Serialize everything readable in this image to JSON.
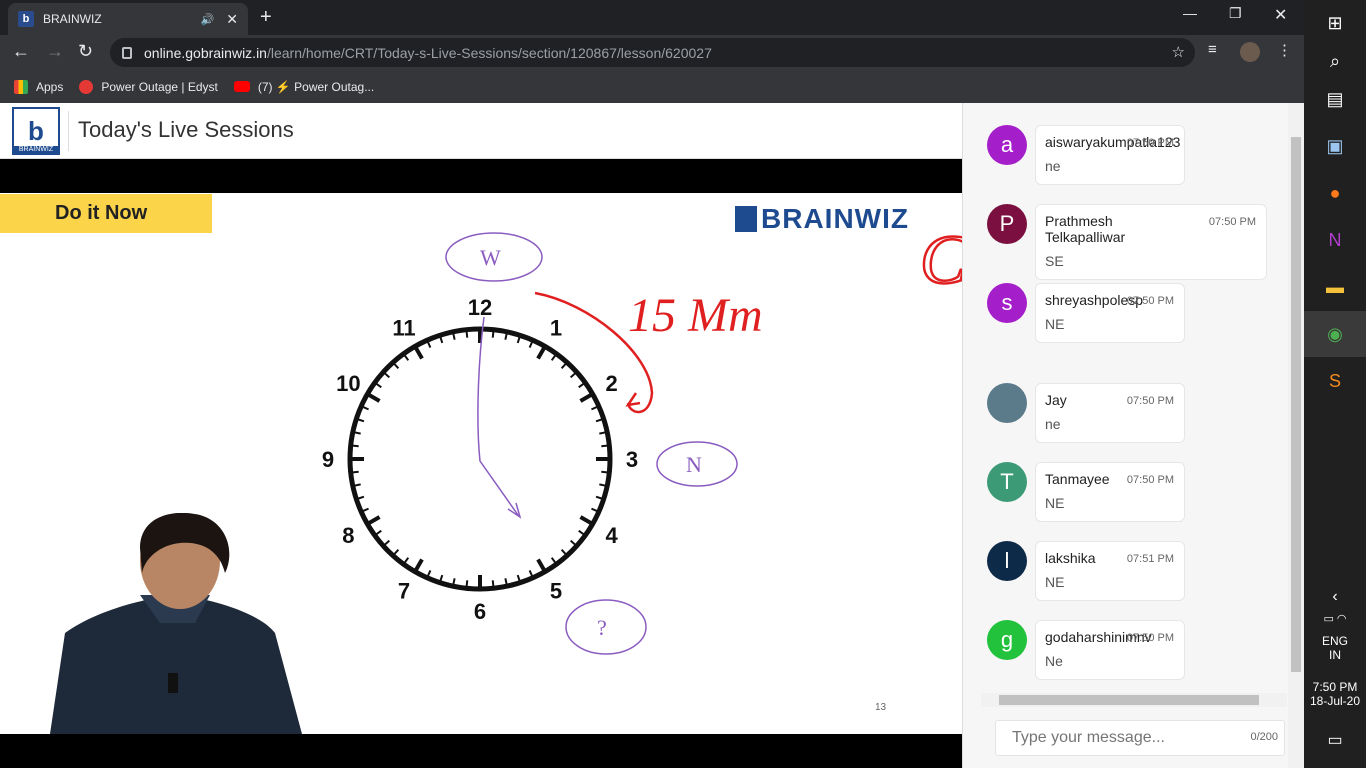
{
  "browser": {
    "tab_title": "BRAINWIZ",
    "url_host": "online.gobrainwiz.in",
    "url_path": "/learn/home/CRT/Today-s-Live-Sessions/section/120867/lesson/620027",
    "bookmarks": [
      "Apps",
      "Power Outage | Edyst",
      "(7) ⚡ Power Outag..."
    ]
  },
  "header": {
    "logo_text": "BRAINWIZ",
    "title": "Today's Live Sessions"
  },
  "slide": {
    "banner": "Do it Now",
    "brand": "BRAINWIZ",
    "page_number": "13",
    "clock_numbers": [
      "12",
      "1",
      "2",
      "3",
      "4",
      "5",
      "6",
      "7",
      "8",
      "9",
      "10",
      "11"
    ],
    "annotations": {
      "top_circle": "W",
      "right_circle": "N",
      "bottom_circle": "?",
      "scribble1": "15 Mm",
      "scribble2": "Chyder"
    }
  },
  "chat": {
    "messages": [
      {
        "avatar": "a",
        "color": "#a41ec9",
        "name": "aiswaryakumpatla123",
        "time": "07:50 PM",
        "text": "ne"
      },
      {
        "avatar": "P",
        "color": "#7b1040",
        "name": "Prathmesh Telkapalliwar",
        "time": "07:50 PM",
        "text": "SE"
      },
      {
        "avatar": "s",
        "color": "#a41ec9",
        "name": "shreyashpolesp",
        "time": "07:50 PM",
        "text": "NE"
      },
      {
        "avatar": "",
        "color": "#5b7a8a",
        "name": "Jay",
        "time": "07:50 PM",
        "text": "ne"
      },
      {
        "avatar": "T",
        "color": "#3c9a76",
        "name": "Tanmayee",
        "time": "07:50 PM",
        "text": "NE"
      },
      {
        "avatar": "l",
        "color": "#0d2a48",
        "name": "lakshika",
        "time": "07:51 PM",
        "text": "NE"
      },
      {
        "avatar": "g",
        "color": "#22c23c",
        "name": "godaharshinimnv",
        "time": "07:50 PM",
        "text": "Ne"
      }
    ],
    "input_placeholder": "Type your message...",
    "counter": "0/200"
  },
  "taskbar": {
    "lang1": "ENG",
    "lang2": "IN",
    "time": "7:50 PM",
    "date": "18-Jul-20"
  }
}
